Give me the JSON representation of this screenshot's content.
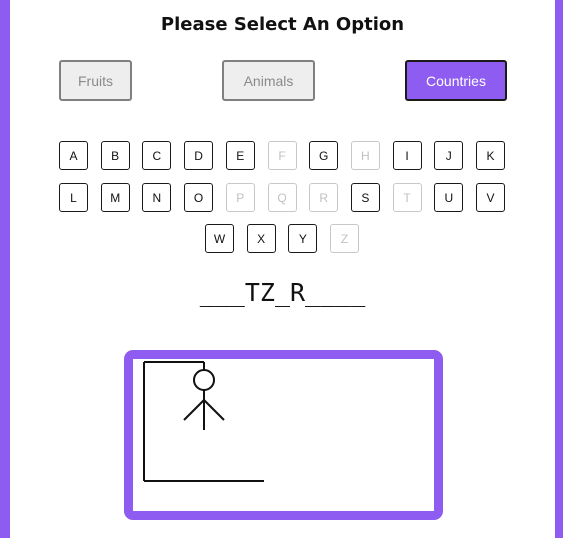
{
  "header": {
    "title": "Please Select An Option"
  },
  "categories": [
    {
      "label": "Fruits",
      "selected": false
    },
    {
      "label": "Animals",
      "selected": false
    },
    {
      "label": "Countries",
      "selected": true
    }
  ],
  "keyboard": {
    "rows": [
      [
        {
          "letter": "A",
          "used": false
        },
        {
          "letter": "B",
          "used": false
        },
        {
          "letter": "C",
          "used": false
        },
        {
          "letter": "D",
          "used": false
        },
        {
          "letter": "E",
          "used": false
        },
        {
          "letter": "F",
          "used": true
        },
        {
          "letter": "G",
          "used": false
        },
        {
          "letter": "H",
          "used": true
        },
        {
          "letter": "I",
          "used": false
        },
        {
          "letter": "J",
          "used": false
        },
        {
          "letter": "K",
          "used": false
        }
      ],
      [
        {
          "letter": "L",
          "used": false
        },
        {
          "letter": "M",
          "used": false
        },
        {
          "letter": "N",
          "used": false
        },
        {
          "letter": "O",
          "used": false
        },
        {
          "letter": "P",
          "used": true
        },
        {
          "letter": "Q",
          "used": true
        },
        {
          "letter": "R",
          "used": true
        },
        {
          "letter": "S",
          "used": false
        },
        {
          "letter": "T",
          "used": true
        },
        {
          "letter": "U",
          "used": false
        },
        {
          "letter": "V",
          "used": false
        }
      ],
      [
        {
          "letter": "W",
          "used": false
        },
        {
          "letter": "X",
          "used": false
        },
        {
          "letter": "Y",
          "used": false
        },
        {
          "letter": "Z",
          "used": true
        }
      ]
    ]
  },
  "puzzle": {
    "display": "___TZ_R____"
  },
  "hangman": {
    "parts_shown": [
      "base",
      "pole",
      "beam",
      "rope",
      "head",
      "body",
      "left-arm",
      "right-arm"
    ]
  },
  "colors": {
    "accent": "#8e5cf0",
    "border": "#1a1a1a",
    "used_key": "#c0c0c0"
  }
}
